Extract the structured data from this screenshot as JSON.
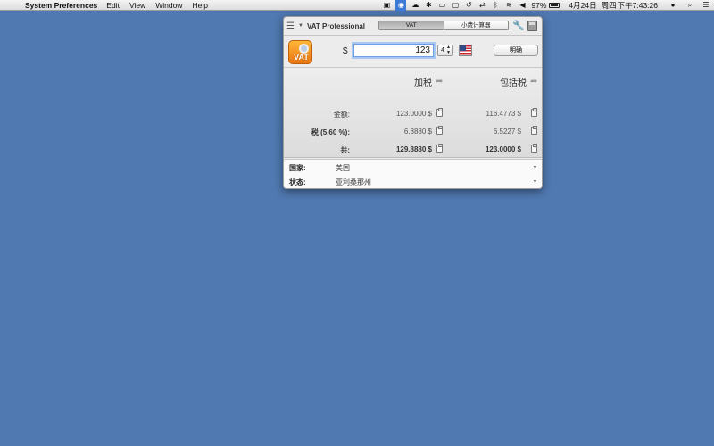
{
  "menubar": {
    "app_name": "System Preferences",
    "menus": [
      "Edit",
      "View",
      "Window",
      "Help"
    ],
    "battery": "97%",
    "date": "4月24日",
    "weekday": "周四",
    "time": "下午7:43:26"
  },
  "panel": {
    "title": "VAT Professional",
    "tabs": [
      "VAT",
      "小费计算器"
    ],
    "selected_tab": "VAT",
    "logo_text": "VAT",
    "currency_symbol": "$",
    "amount": "123",
    "decimals": "4",
    "details_button": "明确",
    "columns": {
      "add_tax": "加税",
      "include_tax": "包括税"
    },
    "rows": [
      {
        "label": "金额:",
        "add": "123.0000 $",
        "incl": "116.4773 $"
      },
      {
        "label": "税 (5.60 %):",
        "add": "6.8880 $",
        "incl": "6.5227 $"
      },
      {
        "label": "共:",
        "add": "129.8880 $",
        "incl": "123.0000 $"
      }
    ],
    "footer": {
      "country_label": "国家:",
      "country_value": "美国",
      "state_label": "状态:",
      "state_value": "亚利桑那州"
    }
  },
  "colors": {
    "desktop": "#5079b1",
    "selection_blue": "#3d7ad8",
    "logo_orange": "#f08a1f"
  }
}
